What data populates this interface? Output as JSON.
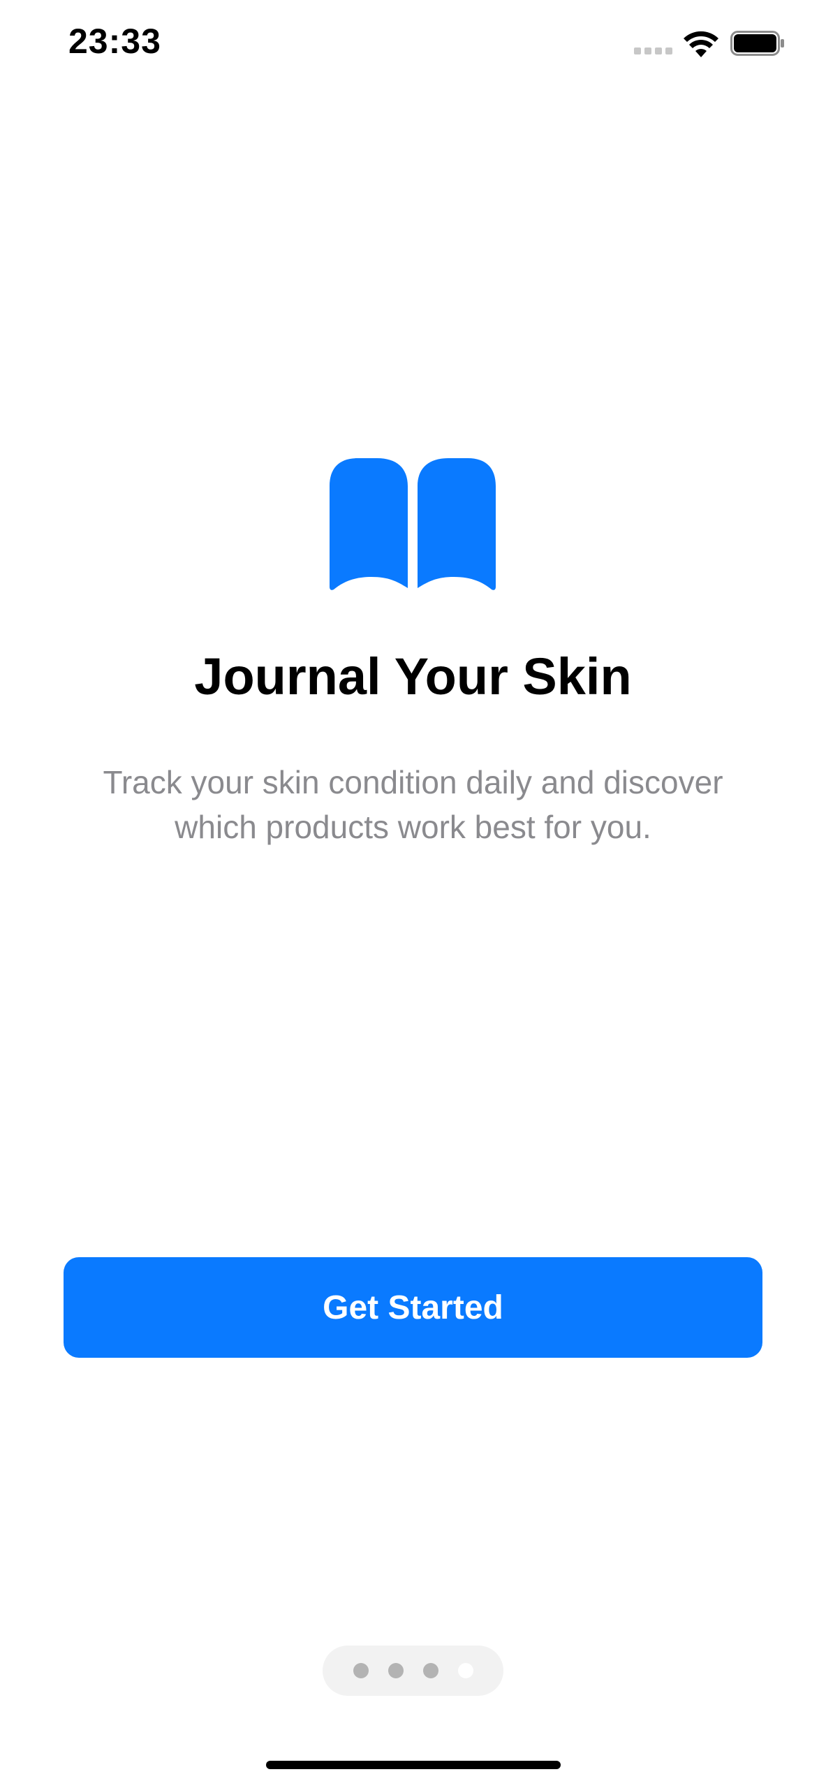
{
  "status_bar": {
    "time": "23:33",
    "icons": [
      "cellular-signal-icon",
      "wifi-icon",
      "battery-icon"
    ]
  },
  "hero": {
    "icon": "book-icon",
    "icon_color": "#0A7AFF",
    "title": "Journal Your Skin",
    "subtitle": "Track your skin condition daily and discover which products work best for you."
  },
  "cta": {
    "label": "Get Started",
    "background_color": "#0A7AFF",
    "text_color": "#FFFFFF"
  },
  "page_indicator": {
    "total_pages": 4,
    "current_page": 4
  },
  "colors": {
    "accent": "#0A7AFF",
    "subtitle_text": "#8A8A8E",
    "background": "#FFFFFF"
  }
}
